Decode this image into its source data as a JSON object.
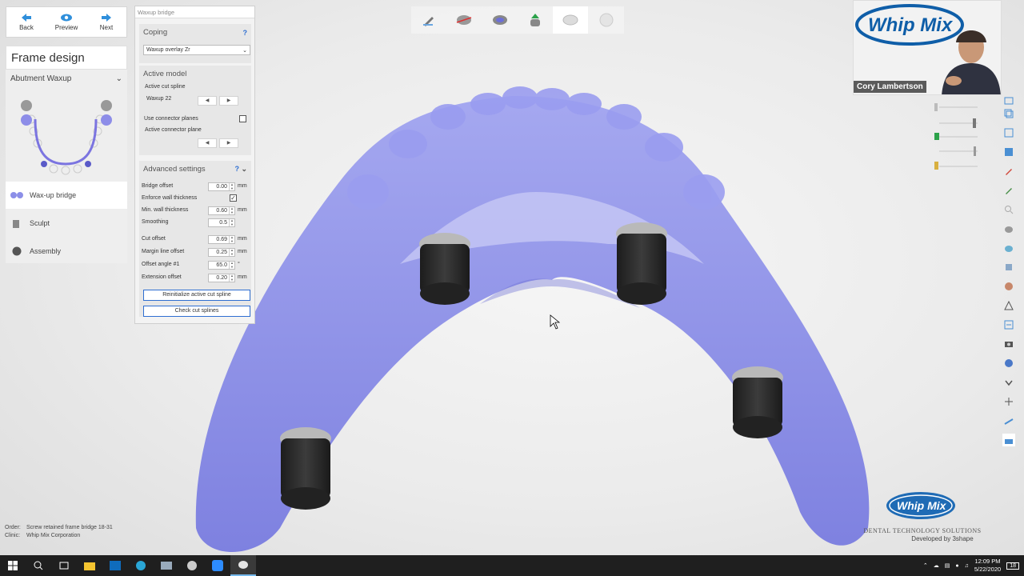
{
  "nav": {
    "back": "Back",
    "preview": "Preview",
    "next": "Next"
  },
  "left_panel": {
    "title": "Frame design",
    "section": "Abutment Waxup",
    "steps": [
      "Wax-up bridge",
      "Sculpt",
      "Assembly"
    ]
  },
  "dialog": {
    "title": "Waxup bridge",
    "coping": {
      "header": "Coping",
      "help": "?",
      "select_value": "Waxup overlay Zr"
    },
    "active_model": {
      "header": "Active model",
      "active_cut_spline_label": "Active cut spline",
      "active_cut_spline_value": "Waxup 22",
      "use_connector_planes": "Use connector planes",
      "use_connector_planes_checked": false,
      "active_connector_plane": "Active connector plane"
    },
    "advanced": {
      "header": "Advanced settings",
      "help": "?",
      "bridge_offset": {
        "label": "Bridge offset",
        "value": "0.00",
        "unit": "mm"
      },
      "enforce_wall_thickness": {
        "label": "Enforce wall thickness",
        "checked": true
      },
      "min_wall_thickness": {
        "label": "Min. wall thickness",
        "value": "0.60",
        "unit": "mm"
      },
      "smoothing": {
        "label": "Smoothing",
        "value": "0.5"
      },
      "cut_offset": {
        "label": "Cut offset",
        "value": "0.69",
        "unit": "mm"
      },
      "margin_line_offset": {
        "label": "Margin line offset",
        "value": "0.25",
        "unit": "mm"
      },
      "offset_angle": {
        "label": "Offset angle #1",
        "value": "65.0",
        "unit": "°"
      },
      "extension_offset": {
        "label": "Extension offset",
        "value": "0.20",
        "unit": "mm"
      },
      "reinit_button": "Reinitialize active cut spline",
      "check_button": "Check cut splines"
    }
  },
  "webcam": {
    "name": "Cory Lambertson",
    "logo_text": "Whip Mix"
  },
  "footer": {
    "order_label": "Order:",
    "order_value": "Screw retained frame bridge 18-31",
    "clinic_label": "Clinic:",
    "clinic_value": "Whip Mix Corporation"
  },
  "brand": {
    "logo_text": "Whip Mix",
    "tagline": "DENTAL TECHNOLOGY SOLUTIONS",
    "developed_by": "Developed by 3shape"
  },
  "taskbar": {
    "time": "12:09 PM",
    "date": "5/22/2020",
    "notification_count": "18"
  },
  "colors": {
    "model": "#8c8fe8",
    "accent": "#2f6fd1",
    "analog": "#2a2a2a",
    "taskbar": "#1f1f1f"
  }
}
